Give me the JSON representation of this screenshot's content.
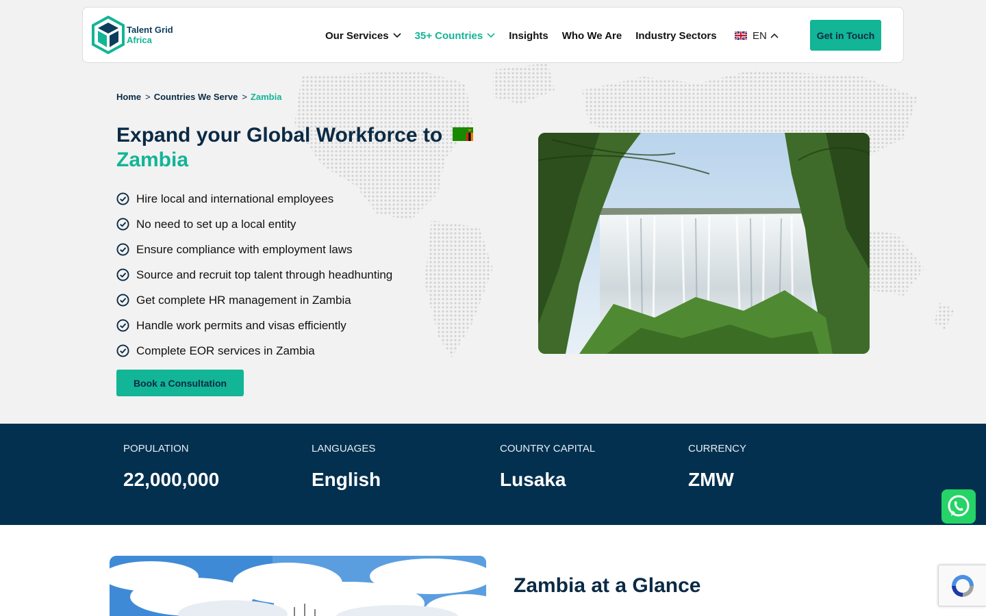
{
  "brand": {
    "line1": "Talent Grid",
    "line2": "Africa"
  },
  "nav": {
    "items": [
      {
        "label": "Our Services",
        "has_dropdown": true
      },
      {
        "label": "35+ Countries",
        "has_dropdown": true,
        "active": true
      },
      {
        "label": "Insights"
      },
      {
        "label": "Who We Are"
      },
      {
        "label": "Industry Sectors"
      }
    ],
    "language": "EN",
    "cta": "Get in Touch"
  },
  "breadcrumb": {
    "home": "Home",
    "sep": ">",
    "parent": "Countries We Serve",
    "current": "Zambia"
  },
  "hero": {
    "title": "Expand your Global Workforce to",
    "country": "Zambia",
    "features": [
      "Hire local and international employees",
      "No need to set up a local entity",
      "Ensure compliance with employment laws",
      "Source and recruit top talent through headhunting",
      "Get complete HR management in Zambia",
      "Handle work permits and visas efficiently",
      "Complete EOR services in Zambia"
    ],
    "button": "Book a Consultation"
  },
  "stats": [
    {
      "label": "POPULATION",
      "value": "22,000,000"
    },
    {
      "label": "LANGUAGES",
      "value": "English"
    },
    {
      "label": "COUNTRY CAPITAL",
      "value": "Lusaka"
    },
    {
      "label": "CURRENCY",
      "value": "ZMW"
    }
  ],
  "glance": {
    "title": "Zambia at a Glance"
  },
  "colors": {
    "accent": "#12b595",
    "navy": "#04304f",
    "text": "#0b2a44",
    "whatsapp": "#25d366"
  }
}
